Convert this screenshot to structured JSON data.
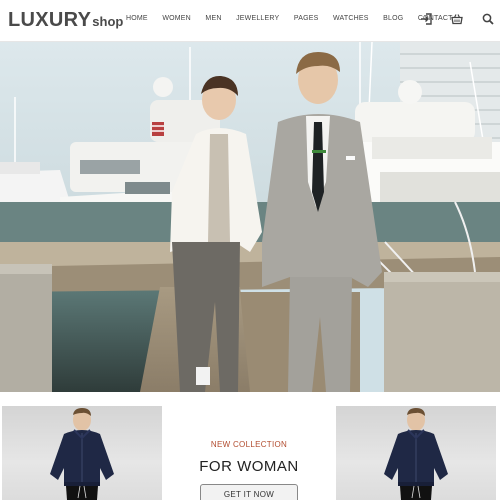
{
  "brand": {
    "main": "LUXURY",
    "sub": "shop"
  },
  "nav": [
    "HOME",
    "WOMEN",
    "MEN",
    "JEWELLERY",
    "PAGES",
    "WATCHES",
    "BLOG",
    "CONTACT"
  ],
  "header_icons": [
    "login-icon",
    "basket-icon",
    "search-icon"
  ],
  "hero": {
    "image": "two male models in suits walking on a marina dock with yachts"
  },
  "promo": {
    "kicker": "NEW COLLECTION",
    "title": "FOR WOMAN",
    "button": "GET IT NOW"
  },
  "products": [
    {
      "image": "model in navy bomber jacket"
    },
    {
      "image": "model in navy bomber jacket"
    }
  ],
  "colors": {
    "accent": "#b24c2f",
    "text": "#222222",
    "logo": "#4a4a4a"
  }
}
